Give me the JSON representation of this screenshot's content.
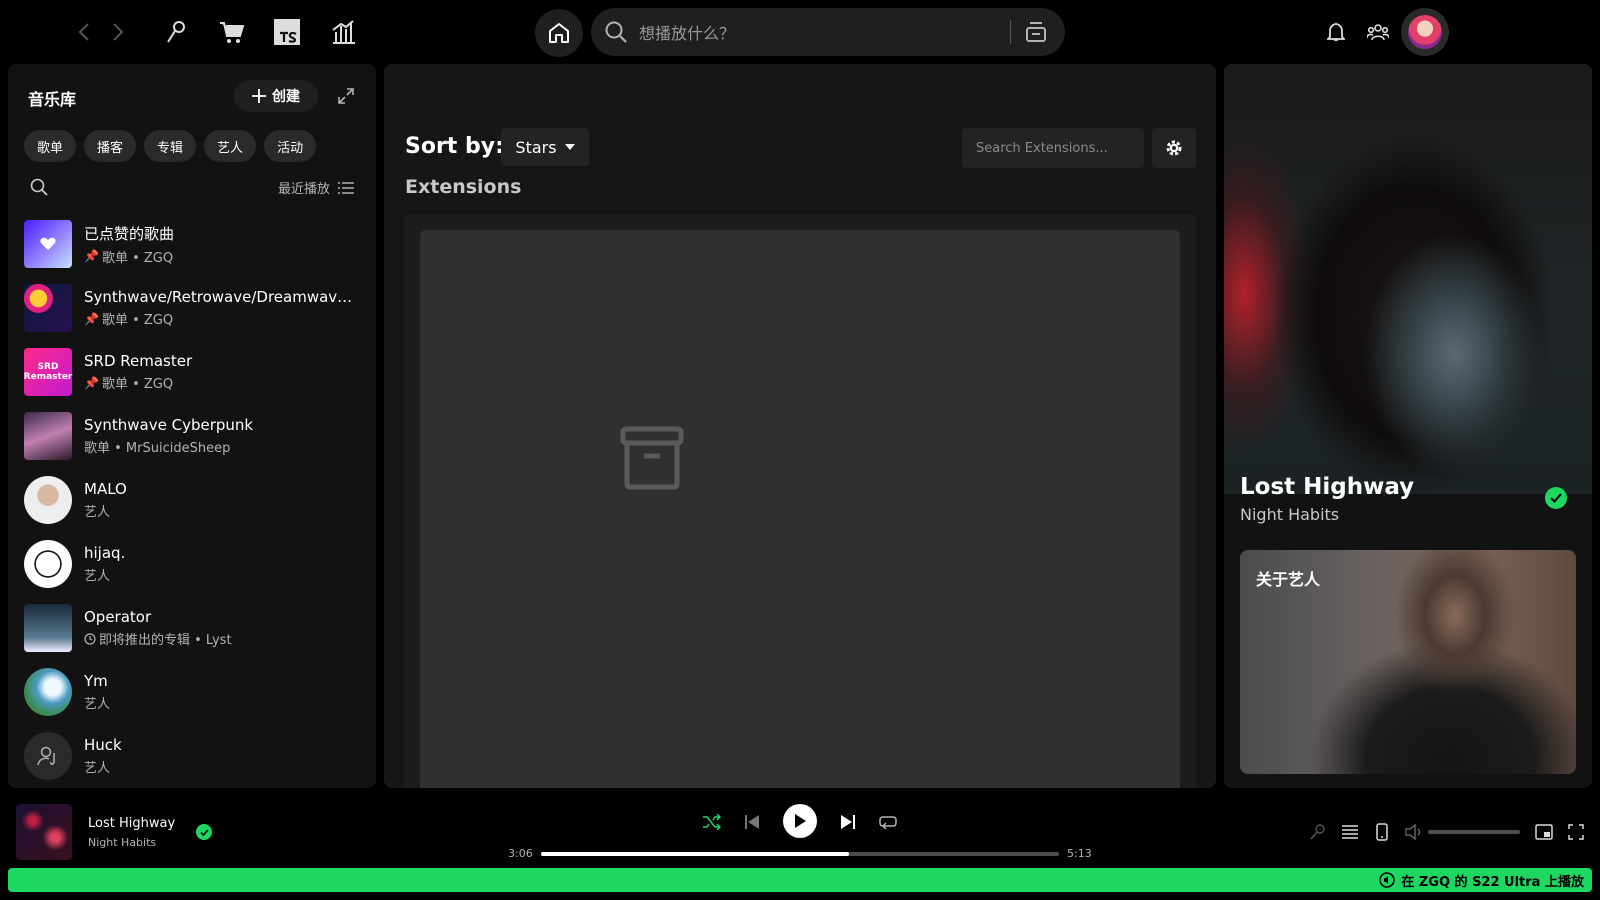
{
  "topbar": {
    "search_placeholder": "想播放什么？"
  },
  "library": {
    "title": "音乐库",
    "create_label": "创建",
    "chips": [
      "歌单",
      "播客",
      "专辑",
      "艺人",
      "活动"
    ],
    "sort_label": "最近播放",
    "items": [
      {
        "title": "已点赞的歌曲",
        "sub": "歌单 • ZGQ",
        "pinned": true
      },
      {
        "title": "Synthwave/Retrowave/Dreamwave ...",
        "sub": "歌单 • ZGQ",
        "pinned": true
      },
      {
        "title": "SRD Remaster",
        "sub": "歌单 • ZGQ",
        "pinned": true,
        "cover_text": "SRD Remaster"
      },
      {
        "title": "Synthwave Cyberpunk",
        "sub": "歌单 • MrSuicideSheep",
        "pinned": false
      },
      {
        "title": "MALO",
        "sub": "艺人",
        "pinned": false
      },
      {
        "title": "hijaq.",
        "sub": "艺人",
        "pinned": false
      },
      {
        "title": "Operator",
        "sub": "即将推出的专辑 • Lyst",
        "pinned": false
      },
      {
        "title": "Ym",
        "sub": "艺人",
        "pinned": false
      },
      {
        "title": "Huck",
        "sub": "艺人",
        "pinned": false
      }
    ]
  },
  "main": {
    "sort_by_label": "Sort by:",
    "sort_value": "Stars",
    "search_placeholder": "Search Extensions...",
    "section_label": "Extensions"
  },
  "right_panel": {
    "track_title": "Lost Highway",
    "artist": "Night Habits",
    "about_label": "关于艺人"
  },
  "player": {
    "title": "Lost Highway",
    "artist": "Night Habits",
    "elapsed": "3:06",
    "duration": "5:13",
    "progress_fraction": 0.594,
    "volume_fraction": 0.0
  },
  "statusbar": {
    "text": "在 ZGQ 的 S22 Ultra 上播放"
  },
  "colors": {
    "accent": "#1ed760",
    "background": "#000000",
    "panel": "#121212"
  }
}
